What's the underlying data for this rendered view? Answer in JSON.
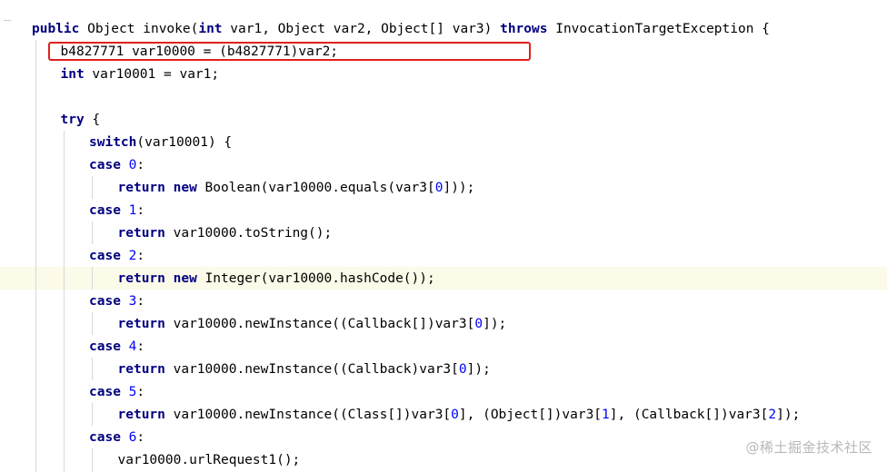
{
  "editor": {
    "highlighted_line": 12,
    "boxed_line": 1,
    "lines": [
      {
        "indent": 0,
        "tokens": [
          {
            "t": "public",
            "k": "kw"
          },
          {
            "t": " Object invoke(",
            "k": "txt"
          },
          {
            "t": "int",
            "k": "kw"
          },
          {
            "t": " var1, Object var2, Object[] var3) ",
            "k": "txt"
          },
          {
            "t": "throws",
            "k": "kw"
          },
          {
            "t": " InvocationTargetException {",
            "k": "txt"
          }
        ]
      },
      {
        "indent": 1,
        "tokens": [
          {
            "t": "b4827771 var10000 = (b4827771)var2;",
            "k": "txt"
          }
        ]
      },
      {
        "indent": 1,
        "tokens": [
          {
            "t": "int",
            "k": "kw"
          },
          {
            "t": " var10001 = var1;",
            "k": "txt"
          }
        ]
      },
      {
        "indent": 1,
        "tokens": []
      },
      {
        "indent": 1,
        "tokens": [
          {
            "t": "try",
            "k": "kw"
          },
          {
            "t": " {",
            "k": "txt"
          }
        ]
      },
      {
        "indent": 2,
        "tokens": [
          {
            "t": "switch",
            "k": "kw"
          },
          {
            "t": "(var10001) {",
            "k": "txt"
          }
        ]
      },
      {
        "indent": 2,
        "tokens": [
          {
            "t": "case",
            "k": "kw"
          },
          {
            "t": " ",
            "k": "txt"
          },
          {
            "t": "0",
            "k": "num"
          },
          {
            "t": ":",
            "k": "txt"
          }
        ]
      },
      {
        "indent": 3,
        "tokens": [
          {
            "t": "return",
            "k": "kw"
          },
          {
            "t": " ",
            "k": "txt"
          },
          {
            "t": "new",
            "k": "kw"
          },
          {
            "t": " Boolean(var10000.equals(var3[",
            "k": "txt"
          },
          {
            "t": "0",
            "k": "num"
          },
          {
            "t": "]));",
            "k": "txt"
          }
        ]
      },
      {
        "indent": 2,
        "tokens": [
          {
            "t": "case",
            "k": "kw"
          },
          {
            "t": " ",
            "k": "txt"
          },
          {
            "t": "1",
            "k": "num"
          },
          {
            "t": ":",
            "k": "txt"
          }
        ]
      },
      {
        "indent": 3,
        "tokens": [
          {
            "t": "return",
            "k": "kw"
          },
          {
            "t": " var10000.toString();",
            "k": "txt"
          }
        ]
      },
      {
        "indent": 2,
        "tokens": [
          {
            "t": "case",
            "k": "kw"
          },
          {
            "t": " ",
            "k": "txt"
          },
          {
            "t": "2",
            "k": "num"
          },
          {
            "t": ":",
            "k": "txt"
          }
        ]
      },
      {
        "indent": 3,
        "tokens": [
          {
            "t": "return",
            "k": "kw"
          },
          {
            "t": " ",
            "k": "txt"
          },
          {
            "t": "new",
            "k": "kw"
          },
          {
            "t": " Integer(var10000.hashCode());",
            "k": "txt"
          }
        ]
      },
      {
        "indent": 2,
        "tokens": [
          {
            "t": "case",
            "k": "kw"
          },
          {
            "t": " ",
            "k": "txt"
          },
          {
            "t": "3",
            "k": "num"
          },
          {
            "t": ":",
            "k": "txt"
          }
        ]
      },
      {
        "indent": 3,
        "tokens": [
          {
            "t": "return",
            "k": "kw"
          },
          {
            "t": " var10000.newInstance((Callback[])var3[",
            "k": "txt"
          },
          {
            "t": "0",
            "k": "num"
          },
          {
            "t": "]);",
            "k": "txt"
          }
        ]
      },
      {
        "indent": 2,
        "tokens": [
          {
            "t": "case",
            "k": "kw"
          },
          {
            "t": " ",
            "k": "txt"
          },
          {
            "t": "4",
            "k": "num"
          },
          {
            "t": ":",
            "k": "txt"
          }
        ]
      },
      {
        "indent": 3,
        "tokens": [
          {
            "t": "return",
            "k": "kw"
          },
          {
            "t": " var10000.newInstance((Callback)var3[",
            "k": "txt"
          },
          {
            "t": "0",
            "k": "num"
          },
          {
            "t": "]);",
            "k": "txt"
          }
        ]
      },
      {
        "indent": 2,
        "tokens": [
          {
            "t": "case",
            "k": "kw"
          },
          {
            "t": " ",
            "k": "txt"
          },
          {
            "t": "5",
            "k": "num"
          },
          {
            "t": ":",
            "k": "txt"
          }
        ]
      },
      {
        "indent": 3,
        "tokens": [
          {
            "t": "return",
            "k": "kw"
          },
          {
            "t": " var10000.newInstance((Class[])var3[",
            "k": "txt"
          },
          {
            "t": "0",
            "k": "num"
          },
          {
            "t": "], (Object[])var3[",
            "k": "txt"
          },
          {
            "t": "1",
            "k": "num"
          },
          {
            "t": "], (Callback[])var3[",
            "k": "txt"
          },
          {
            "t": "2",
            "k": "num"
          },
          {
            "t": "]);",
            "k": "txt"
          }
        ]
      },
      {
        "indent": 2,
        "tokens": [
          {
            "t": "case",
            "k": "kw"
          },
          {
            "t": " ",
            "k": "txt"
          },
          {
            "t": "6",
            "k": "num"
          },
          {
            "t": ":",
            "k": "txt"
          }
        ]
      },
      {
        "indent": 3,
        "tokens": [
          {
            "t": "var10000.urlRequest1();",
            "k": "txt"
          }
        ]
      }
    ]
  },
  "watermark": {
    "text": "@稀土掘金技术社区"
  },
  "colors": {
    "keyword": "#000080",
    "number": "#0000ff",
    "highlight": "#fcfae8",
    "box": "#e0201a"
  }
}
